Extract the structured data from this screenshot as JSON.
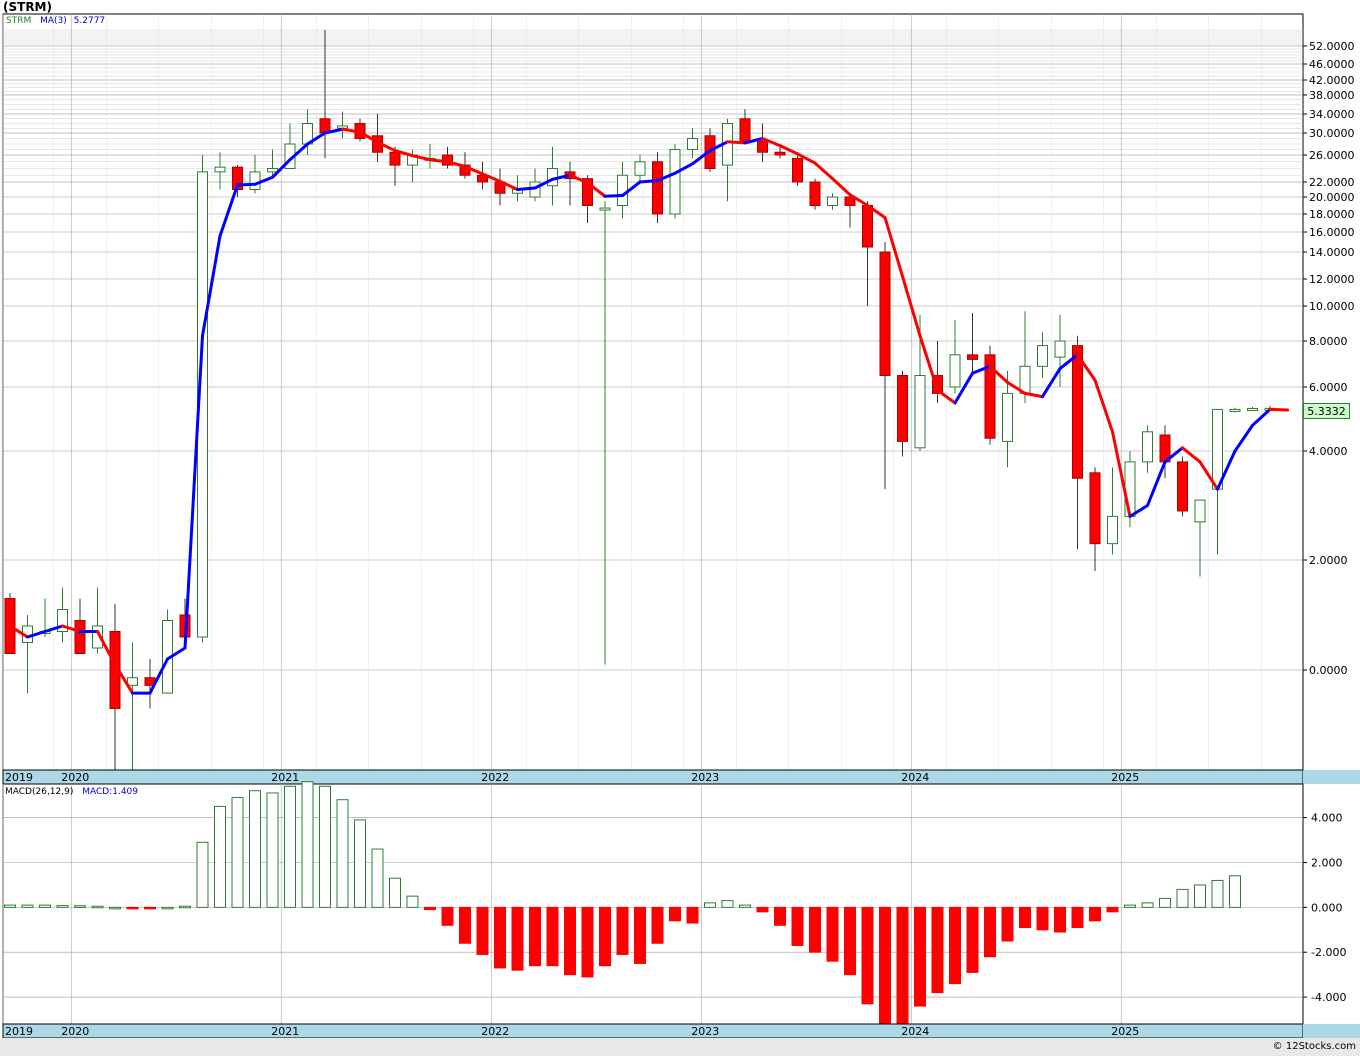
{
  "header": {
    "title": "(STRM)"
  },
  "legend": {
    "ticker": "STRM",
    "ma_label": "MA(3)",
    "ma_value": "5.2777",
    "macd_label": "MACD(26,12,9)",
    "macd_value": "MACD:1.409"
  },
  "last_price": {
    "text": "5.3332",
    "value": 5.3332
  },
  "footer": {
    "copyright": "© 12Stocks.com"
  },
  "colors": {
    "up": "#ffffff",
    "up_stroke": "#2e7d32",
    "down": "#ff0000",
    "down_stroke": "#b00000",
    "ma_up": "#0000ff",
    "ma_down": "#ff0000",
    "grid": "#999999",
    "axis_band": "#add8e6",
    "price_box": "#ccffcc",
    "macd_pos": "#ffffff",
    "macd_pos_stroke": "#2e7d32",
    "macd_neg": "#ff0000"
  },
  "chart_data": [
    {
      "type": "candlestick",
      "title": "STRM",
      "y_scale": "log-like",
      "y_ticks": [
        "52.0000",
        "46.0000",
        "42.0000",
        "38.0000",
        "34.0000",
        "30.0000",
        "26.0000",
        "22.0000",
        "20.0000",
        "18.0000",
        "16.0000",
        "14.0000",
        "12.0000",
        "10.0000",
        "8.0000",
        "6.0000",
        "4.0000",
        "2.0000",
        "0.0000"
      ],
      "x_ticks": [
        "2019",
        "2020",
        "2021",
        "2022",
        "2023",
        "2024",
        "2025"
      ],
      "candles": [
        {
          "d": "2019-10",
          "o": 1.3,
          "h": 1.4,
          "l": 0.3,
          "c": 0.3
        },
        {
          "d": "2019-11",
          "o": 0.5,
          "h": 1.0,
          "l": -0.3,
          "c": 0.8
        },
        {
          "d": "2019-12",
          "o": 0.7,
          "h": 1.3,
          "l": 0.6,
          "c": 0.7
        },
        {
          "d": "2020-01",
          "o": 0.7,
          "h": 1.5,
          "l": 0.5,
          "c": 1.1
        },
        {
          "d": "2020-02",
          "o": 0.9,
          "h": 1.3,
          "l": 0.3,
          "c": 0.3
        },
        {
          "d": "2020-03",
          "o": 0.4,
          "h": 1.5,
          "l": 0.3,
          "c": 0.8
        },
        {
          "d": "2020-04",
          "o": 0.7,
          "h": 1.2,
          "l": -1.3,
          "c": -0.5
        },
        {
          "d": "2020-05",
          "o": -0.2,
          "h": 0.5,
          "l": -1.3,
          "c": -0.1
        },
        {
          "d": "2020-06",
          "o": -0.1,
          "h": 0.2,
          "l": -0.5,
          "c": -0.2
        },
        {
          "d": "2020-07",
          "o": -0.3,
          "h": 1.1,
          "l": -0.3,
          "c": 0.9
        },
        {
          "d": "2020-08",
          "o": 1.0,
          "h": 1.3,
          "l": 0.6,
          "c": 0.6
        },
        {
          "d": "2020-09",
          "o": 0.6,
          "h": 26.0,
          "l": 0.5,
          "c": 23.5
        },
        {
          "d": "2020-10",
          "o": 23.5,
          "h": 26.5,
          "l": 21.0,
          "c": 24.2
        },
        {
          "d": "2020-11",
          "o": 24.2,
          "h": 24.5,
          "l": 20.0,
          "c": 21.0
        },
        {
          "d": "2020-12",
          "o": 21.0,
          "h": 26.0,
          "l": 20.5,
          "c": 23.5
        },
        {
          "d": "2021-01",
          "o": 23.5,
          "h": 27.0,
          "l": 22.5,
          "c": 24.0
        },
        {
          "d": "2021-02",
          "o": 24.0,
          "h": 32.0,
          "l": 24.0,
          "c": 28.0
        },
        {
          "d": "2021-03",
          "o": 28.0,
          "h": 35.0,
          "l": 26.0,
          "c": 32.0
        },
        {
          "d": "2021-04",
          "o": 33.0,
          "h": 60.0,
          "l": 25.5,
          "c": 30.0
        },
        {
          "d": "2021-05",
          "o": 31.0,
          "h": 34.5,
          "l": 29.0,
          "c": 31.5
        },
        {
          "d": "2021-06",
          "o": 32.0,
          "h": 33.0,
          "l": 28.5,
          "c": 29.0
        },
        {
          "d": "2021-07",
          "o": 29.5,
          "h": 34.0,
          "l": 25.0,
          "c": 26.5
        },
        {
          "d": "2021-08",
          "o": 26.5,
          "h": 27.5,
          "l": 21.5,
          "c": 24.5
        },
        {
          "d": "2021-09",
          "o": 24.5,
          "h": 27.0,
          "l": 22.0,
          "c": 26.0
        },
        {
          "d": "2021-10",
          "o": 25.5,
          "h": 28.0,
          "l": 24.0,
          "c": 25.5
        },
        {
          "d": "2021-11",
          "o": 26.0,
          "h": 27.5,
          "l": 24.0,
          "c": 24.5
        },
        {
          "d": "2021-12",
          "o": 24.5,
          "h": 26.5,
          "l": 22.5,
          "c": 23.0
        },
        {
          "d": "2022-01",
          "o": 23.0,
          "h": 25.0,
          "l": 21.0,
          "c": 22.0
        },
        {
          "d": "2022-02",
          "o": 22.0,
          "h": 24.0,
          "l": 19.0,
          "c": 20.5
        },
        {
          "d": "2022-03",
          "o": 20.5,
          "h": 23.0,
          "l": 19.5,
          "c": 21.0
        },
        {
          "d": "2022-04",
          "o": 20.0,
          "h": 24.0,
          "l": 19.5,
          "c": 22.0
        },
        {
          "d": "2022-05",
          "o": 21.5,
          "h": 27.5,
          "l": 19.0,
          "c": 24.0
        },
        {
          "d": "2022-06",
          "o": 23.5,
          "h": 25.0,
          "l": 19.0,
          "c": 22.5
        },
        {
          "d": "2022-07",
          "o": 22.5,
          "h": 23.0,
          "l": 17.0,
          "c": 19.0
        },
        {
          "d": "2022-08",
          "o": 18.5,
          "h": 19.5,
          "l": 0.1,
          "c": 18.7
        },
        {
          "d": "2022-09",
          "o": 19.0,
          "h": 25.0,
          "l": 17.5,
          "c": 23.0
        },
        {
          "d": "2022-10",
          "o": 23.0,
          "h": 26.0,
          "l": 22.0,
          "c": 25.0
        },
        {
          "d": "2022-11",
          "o": 25.0,
          "h": 26.5,
          "l": 17.0,
          "c": 18.0
        },
        {
          "d": "2022-12",
          "o": 18.0,
          "h": 28.0,
          "l": 17.5,
          "c": 27.0
        },
        {
          "d": "2023-01",
          "o": 27.0,
          "h": 31.0,
          "l": 25.5,
          "c": 29.0
        },
        {
          "d": "2023-02",
          "o": 29.5,
          "h": 31.0,
          "l": 23.5,
          "c": 24.0
        },
        {
          "d": "2023-03",
          "o": 24.5,
          "h": 33.0,
          "l": 19.5,
          "c": 32.0
        },
        {
          "d": "2023-04",
          "o": 33.0,
          "h": 35.0,
          "l": 28.5,
          "c": 28.5
        },
        {
          "d": "2023-05",
          "o": 28.5,
          "h": 32.0,
          "l": 25.0,
          "c": 26.5
        },
        {
          "d": "2023-06",
          "o": 26.5,
          "h": 27.5,
          "l": 25.5,
          "c": 26.0
        },
        {
          "d": "2023-07",
          "o": 25.5,
          "h": 26.5,
          "l": 21.5,
          "c": 22.0
        },
        {
          "d": "2023-08",
          "o": 22.0,
          "h": 22.5,
          "l": 18.5,
          "c": 19.0
        },
        {
          "d": "2023-09",
          "o": 19.0,
          "h": 20.5,
          "l": 18.5,
          "c": 20.0
        },
        {
          "d": "2023-10",
          "o": 20.0,
          "h": 20.5,
          "l": 16.5,
          "c": 19.0
        },
        {
          "d": "2023-11",
          "o": 19.0,
          "h": 19.5,
          "l": 10.0,
          "c": 14.5
        },
        {
          "d": "2023-12",
          "o": 14.0,
          "h": 15.0,
          "l": 3.3,
          "c": 6.5
        },
        {
          "d": "2024-01",
          "o": 6.5,
          "h": 6.7,
          "l": 3.9,
          "c": 4.3
        },
        {
          "d": "2024-02",
          "o": 4.1,
          "h": 9.5,
          "l": 4.0,
          "c": 6.5
        },
        {
          "d": "2024-03",
          "o": 6.5,
          "h": 8.0,
          "l": 5.5,
          "c": 5.8
        },
        {
          "d": "2024-04",
          "o": 6.0,
          "h": 9.2,
          "l": 5.8,
          "c": 7.4
        },
        {
          "d": "2024-05",
          "o": 7.4,
          "h": 9.6,
          "l": 6.5,
          "c": 7.2
        },
        {
          "d": "2024-06",
          "o": 7.4,
          "h": 7.8,
          "l": 4.2,
          "c": 4.4
        },
        {
          "d": "2024-07",
          "o": 4.3,
          "h": 6.7,
          "l": 3.7,
          "c": 5.8
        },
        {
          "d": "2024-08",
          "o": 5.8,
          "h": 9.7,
          "l": 5.5,
          "c": 6.9
        },
        {
          "d": "2024-09",
          "o": 6.9,
          "h": 8.5,
          "l": 6.4,
          "c": 7.8
        },
        {
          "d": "2024-10",
          "o": 7.3,
          "h": 9.5,
          "l": 6.0,
          "c": 8.0
        },
        {
          "d": "2024-11",
          "o": 7.8,
          "h": 8.3,
          "l": 2.2,
          "c": 3.5
        },
        {
          "d": "2024-12",
          "o": 3.6,
          "h": 3.7,
          "l": 1.8,
          "c": 2.3
        },
        {
          "d": "2025-01",
          "o": 2.3,
          "h": 3.7,
          "l": 2.1,
          "c": 2.8
        },
        {
          "d": "2025-02",
          "o": 2.8,
          "h": 4.0,
          "l": 2.6,
          "c": 3.8
        },
        {
          "d": "2025-03",
          "o": 3.8,
          "h": 4.8,
          "l": 3.6,
          "c": 4.6
        },
        {
          "d": "2025-04",
          "o": 4.5,
          "h": 4.8,
          "l": 3.5,
          "c": 3.8
        },
        {
          "d": "2025-05",
          "o": 3.8,
          "h": 3.9,
          "l": 2.8,
          "c": 2.9
        },
        {
          "d": "2025-06",
          "o": 2.7,
          "h": 3.1,
          "l": 1.7,
          "c": 3.1
        },
        {
          "d": "2025-07",
          "o": 3.3,
          "h": 5.3,
          "l": 2.1,
          "c": 5.3
        },
        {
          "d": "2025-08",
          "o": 5.3,
          "h": 5.35,
          "l": 5.2,
          "c": 5.3
        },
        {
          "d": "2025-09",
          "o": 5.3,
          "h": 5.38,
          "l": 5.25,
          "c": 5.33
        },
        {
          "d": "2025-10",
          "o": 5.3,
          "h": 5.42,
          "l": 5.25,
          "c": 5.3333
        }
      ],
      "ma3": [
        0.8,
        0.6,
        0.7,
        0.8,
        0.7,
        0.7,
        0.1,
        -0.3,
        -0.3,
        0.2,
        0.4,
        8.3,
        15.6,
        21.6,
        21.7,
        22.7,
        25.3,
        28.0,
        30.0,
        30.8,
        30.2,
        28.3,
        26.8,
        25.9,
        25.3,
        25.0,
        24.3,
        23.2,
        22.1,
        21.0,
        21.2,
        22.4,
        23.0,
        21.9,
        20.1,
        20.2,
        22.0,
        22.2,
        23.3,
        24.7,
        26.8,
        28.4,
        28.2,
        29.0,
        27.7,
        26.2,
        24.8,
        22.5,
        20.3,
        19.0,
        17.6,
        12.2,
        8.3,
        5.9,
        5.5,
        6.6,
        6.9,
        6.2,
        5.8,
        5.7,
        6.8,
        7.4,
        6.3,
        4.6,
        2.8,
        3.0,
        3.8,
        4.1,
        3.8,
        3.3,
        4.0,
        4.8,
        5.3,
        5.28
      ]
    },
    {
      "type": "bar",
      "title": "MACD(26,12,9)",
      "y_ticks": [
        "4.000",
        "2.000",
        "0.000",
        "-2.000",
        "-4.000"
      ],
      "ylim": [
        -5.2,
        5.5
      ],
      "values": [
        0.1,
        0.1,
        0.1,
        0.08,
        0.07,
        0.05,
        0.0,
        -0.05,
        -0.06,
        0.0,
        0.05,
        2.9,
        4.5,
        4.9,
        5.2,
        5.1,
        5.4,
        5.6,
        5.4,
        4.8,
        3.9,
        2.6,
        1.3,
        0.5,
        -0.1,
        -0.8,
        -1.6,
        -2.1,
        -2.7,
        -2.8,
        -2.6,
        -2.6,
        -3.0,
        -3.1,
        -2.6,
        -2.1,
        -2.5,
        -1.6,
        -0.6,
        -0.7,
        0.2,
        0.3,
        0.1,
        -0.2,
        -0.8,
        -1.7,
        -2.0,
        -2.4,
        -3.0,
        -4.3,
        -5.3,
        -5.2,
        -4.4,
        -3.8,
        -3.4,
        -2.9,
        -2.2,
        -1.5,
        -0.9,
        -1.0,
        -1.1,
        -0.9,
        -0.6,
        -0.2,
        0.1,
        0.2,
        0.4,
        0.8,
        1.0,
        1.2,
        1.409
      ]
    }
  ]
}
